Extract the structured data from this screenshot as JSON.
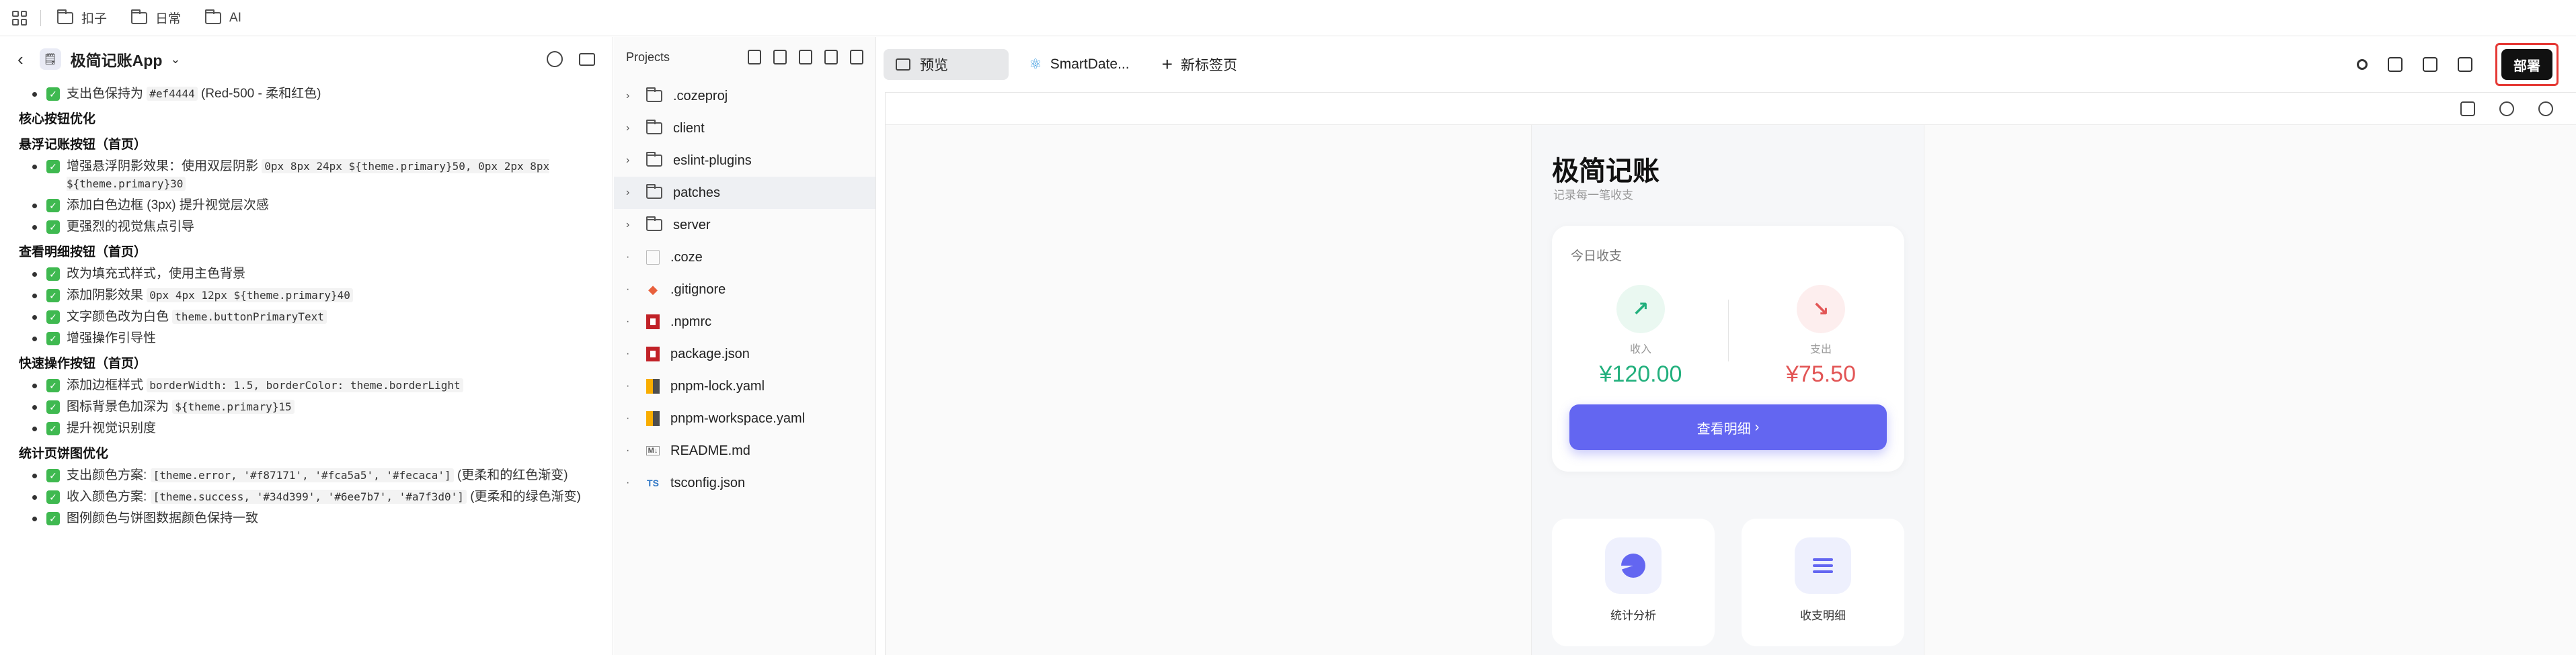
{
  "bookmarks": [
    "扣子",
    "日常",
    "AI"
  ],
  "left": {
    "app_title": "极简记账App",
    "items": [
      {
        "type": "li",
        "check": true,
        "text": "支出色保持为 ",
        "code": "#ef4444",
        "tail": " (Red-500 - 柔和红色)"
      },
      {
        "type": "h",
        "text": "核心按钮优化"
      },
      {
        "type": "h",
        "text": "悬浮记账按钮（首页）"
      },
      {
        "type": "li",
        "check": true,
        "text": "增强悬浮阴影效果：使用双层阴影 ",
        "code": "0px 8px 24px ${theme.primary}50, 0px 2px 8px ${theme.primary}30",
        "tail": ""
      },
      {
        "type": "li",
        "check": true,
        "text": "添加白色边框 (3px) 提升视觉层次感",
        "code": "",
        "tail": ""
      },
      {
        "type": "li",
        "check": true,
        "text": "更强烈的视觉焦点引导",
        "code": "",
        "tail": ""
      },
      {
        "type": "h",
        "text": "查看明细按钮（首页）"
      },
      {
        "type": "li",
        "check": true,
        "text": "改为填充式样式，使用主色背景",
        "code": "",
        "tail": ""
      },
      {
        "type": "li",
        "check": true,
        "text": "添加阴影效果 ",
        "code": "0px 4px 12px ${theme.primary}40",
        "tail": ""
      },
      {
        "type": "li",
        "check": true,
        "text": "文字颜色改为白色 ",
        "code": "theme.buttonPrimaryText",
        "tail": ""
      },
      {
        "type": "li",
        "check": true,
        "text": "增强操作引导性",
        "code": "",
        "tail": ""
      },
      {
        "type": "h",
        "text": "快速操作按钮（首页）"
      },
      {
        "type": "li",
        "check": true,
        "text": "添加边框样式 ",
        "code": "borderWidth: 1.5, borderColor: theme.borderLight",
        "tail": ""
      },
      {
        "type": "li",
        "check": true,
        "text": "图标背景色加深为 ",
        "code": "${theme.primary}15",
        "tail": ""
      },
      {
        "type": "li",
        "check": true,
        "text": "提升视觉识别度",
        "code": "",
        "tail": ""
      },
      {
        "type": "h",
        "text": "统计页饼图优化"
      },
      {
        "type": "li",
        "check": true,
        "text": "支出颜色方案: ",
        "code": "[theme.error, '#f87171', '#fca5a5', '#fecaca']",
        "tail": " (更柔和的红色渐变)"
      },
      {
        "type": "li",
        "check": true,
        "text": "收入颜色方案: ",
        "code": "[theme.success, '#34d399', '#6ee7b7', '#a7f3d0']",
        "tail": " (更柔和的绿色渐变)"
      },
      {
        "type": "li",
        "check": true,
        "text": "图例颜色与饼图数据颜色保持一致",
        "code": "",
        "tail": ""
      }
    ]
  },
  "projects": {
    "title": "Projects",
    "files": [
      {
        "name": ".cozeproj",
        "kind": "folder"
      },
      {
        "name": "client",
        "kind": "folder"
      },
      {
        "name": "eslint-plugins",
        "kind": "folder"
      },
      {
        "name": "patches",
        "kind": "folder",
        "selected": true
      },
      {
        "name": "server",
        "kind": "folder"
      },
      {
        "name": ".coze",
        "kind": "doc"
      },
      {
        "name": ".gitignore",
        "kind": "git"
      },
      {
        "name": ".npmrc",
        "kind": "npm"
      },
      {
        "name": "package.json",
        "kind": "npm"
      },
      {
        "name": "pnpm-lock.yaml",
        "kind": "pnpm"
      },
      {
        "name": "pnpm-workspace.yaml",
        "kind": "pnpm"
      },
      {
        "name": "README.md",
        "kind": "md"
      },
      {
        "name": "tsconfig.json",
        "kind": "ts"
      }
    ]
  },
  "tabs": {
    "preview": "预览",
    "smartdate": "SmartDate...",
    "new_tab": "新标签页",
    "deploy": "部署"
  },
  "app": {
    "title": "极简记账",
    "subtitle": "记录每一笔收支",
    "today_label": "今日收支",
    "income_label": "收入",
    "income_value": "¥120.00",
    "expense_label": "支出",
    "expense_value": "¥75.50",
    "detail_button": "查看明细",
    "quick_stats": "统计分析",
    "quick_details": "收支明细"
  },
  "colors": {
    "primary": "#6366f1",
    "income": "#22b07d",
    "expense": "#e25555",
    "deploy_highlight": "#e53935"
  }
}
